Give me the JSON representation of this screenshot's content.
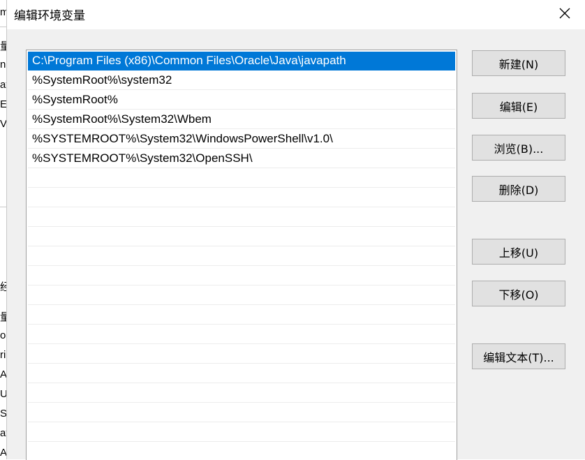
{
  "dialog": {
    "title": "编辑环境变量",
    "close_icon": "close-icon"
  },
  "paths": [
    "C:\\Program Files (x86)\\Common Files\\Oracle\\Java\\javapath",
    "%SystemRoot%\\system32",
    "%SystemRoot%",
    "%SystemRoot%\\System32\\Wbem",
    "%SYSTEMROOT%\\System32\\WindowsPowerShell\\v1.0\\",
    "%SYSTEMROOT%\\System32\\OpenSSH\\"
  ],
  "selected_index": 0,
  "buttons": {
    "new": "新建(N)",
    "edit": "编辑(E)",
    "browse": "浏览(B)...",
    "delete": "删除(D)",
    "move_up": "上移(U)",
    "move_down": "下移(O)",
    "edit_text": "编辑文本(T)..."
  },
  "background_window": {
    "fragments": [
      "m",
      "量",
      "n",
      "at",
      "E",
      "V",
      "经",
      "量",
      "o",
      "ri",
      "A",
      "U",
      "S",
      "at",
      "A"
    ]
  },
  "colors": {
    "selection": "#0078d7",
    "dialog_bg": "#f0f0f0",
    "button_bg": "#e1e1e1"
  }
}
